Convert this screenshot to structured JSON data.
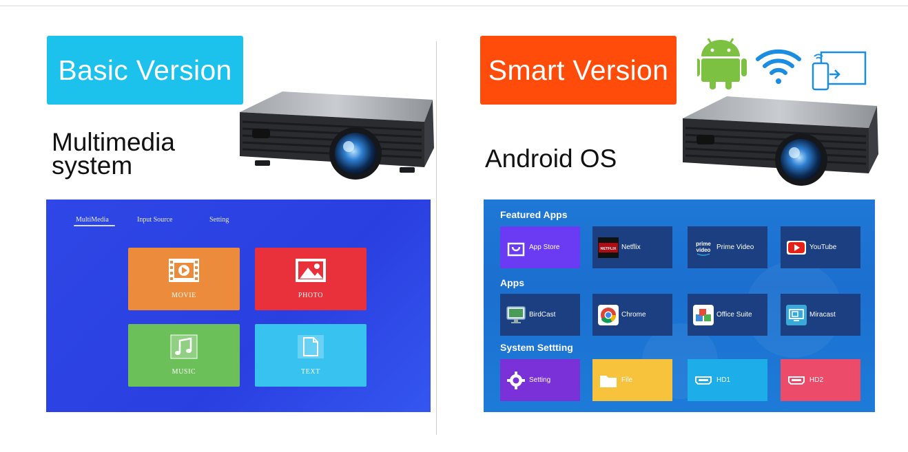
{
  "left": {
    "badge": "Basic Version",
    "subtitle_line1": "Multimedia",
    "subtitle_line2": "system",
    "screen": {
      "nav": [
        "MultiMedia",
        "Input Source",
        "Setting"
      ],
      "tiles": [
        "MOVIE",
        "PHOTO",
        "MUSIC",
        "TEXT"
      ]
    }
  },
  "right": {
    "badge": "Smart Version",
    "subtitle": "Android OS",
    "top_icons": [
      "android-icon",
      "wifi-icon",
      "screen-mirror-icon"
    ],
    "screen": {
      "sections": [
        "Featured Apps",
        "Apps",
        "System Settting"
      ],
      "featured": [
        "App Store",
        "Netflix",
        "Prime Video",
        "YouTube"
      ],
      "apps": [
        "BirdCast",
        "Chrome",
        "Office Suite",
        "Miracast"
      ],
      "system": [
        "Setting",
        "File",
        "HD1",
        "HD2"
      ],
      "prime_logo_line1": "prime",
      "prime_logo_line2": "video",
      "netflix_logo": "NETFLIX"
    }
  },
  "colors": {
    "basic_badge": "#1cc1ec",
    "smart_badge": "#ff4c0b",
    "android_green": "#7cc142",
    "wifi_blue": "#1a8de3",
    "movie_tile": "#ed8b3c",
    "photo_tile": "#e8313b",
    "music_tile": "#6cc05a",
    "text_tile": "#37c2ef"
  }
}
